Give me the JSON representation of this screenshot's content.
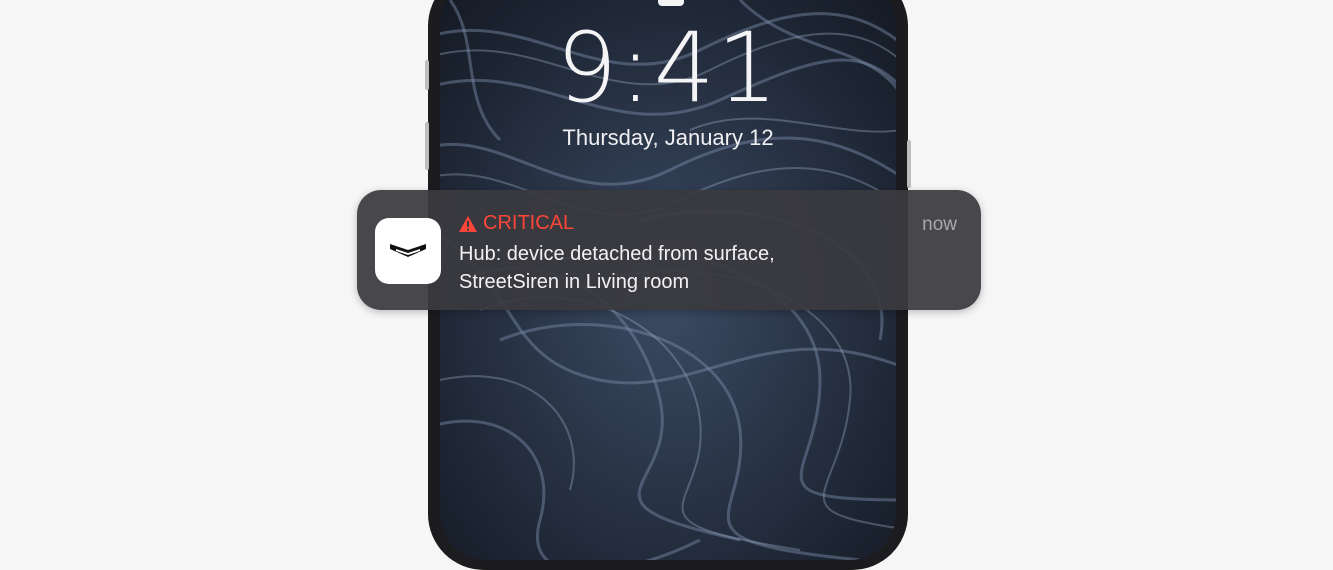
{
  "lock_screen": {
    "time": "9:41",
    "date": "Thursday, January 12"
  },
  "notification": {
    "app_icon": "ajax-logo-icon",
    "severity_icon": "warning-triangle-icon",
    "severity": "CRITICAL",
    "message_line1": "Hub: device detached from surface,",
    "message_line2": "StreetSiren in Living room",
    "time": "now"
  },
  "colors": {
    "background": "#f6f6f6",
    "critical": "#ff453a",
    "notification_bg": "#3a3a3e",
    "wallpaper": "#1e2633"
  }
}
